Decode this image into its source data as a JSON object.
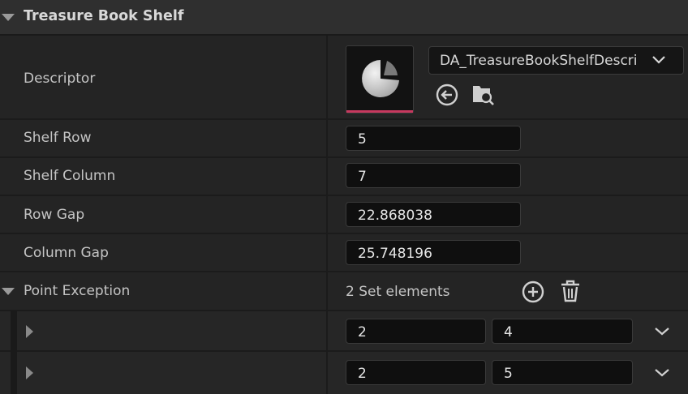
{
  "section": {
    "title": "Treasure Book Shelf"
  },
  "descriptor": {
    "label": "Descriptor",
    "asset_name": "DA_TreasureBookShelfDescri",
    "thumbnail_bar_color": "#c7395f",
    "thumbnail_icon": "pie-chart-icon",
    "use_selected_icon": "arrow-left-circle-icon",
    "browse_icon": "folder-search-icon",
    "dropdown_icon": "chevron-down-icon"
  },
  "fields": {
    "shelf_row": {
      "label": "Shelf Row",
      "value": "5"
    },
    "shelf_column": {
      "label": "Shelf Column",
      "value": "7"
    },
    "row_gap": {
      "label": "Row Gap",
      "value": "22.868038"
    },
    "column_gap": {
      "label": "Column Gap",
      "value": "25.748196"
    }
  },
  "point_exception": {
    "label": "Point Exception",
    "count_text": "2 Set elements",
    "add_icon": "plus-circle-icon",
    "clear_icon": "trash-icon",
    "elements": [
      {
        "x": "2",
        "y": "4"
      },
      {
        "x": "2",
        "y": "5"
      }
    ]
  }
}
